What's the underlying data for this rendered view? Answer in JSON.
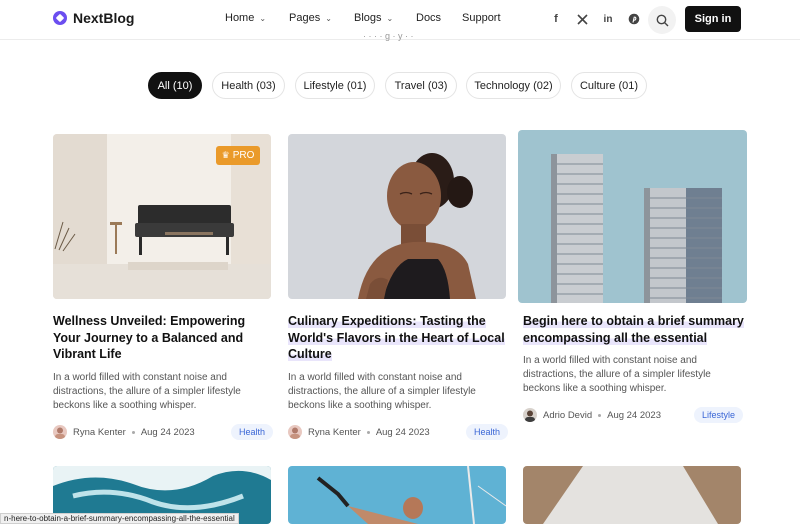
{
  "brand": {
    "name": "NextBlog",
    "accent": "#6b4ef0"
  },
  "nav": {
    "items": [
      {
        "label": "Home",
        "has_dropdown": true
      },
      {
        "label": "Pages",
        "has_dropdown": true
      },
      {
        "label": "Blogs",
        "has_dropdown": true
      },
      {
        "label": "Docs",
        "has_dropdown": false
      },
      {
        "label": "Support",
        "has_dropdown": false
      }
    ]
  },
  "social": [
    "facebook-icon",
    "x-icon",
    "linkedin-icon",
    "pinterest-icon"
  ],
  "header": {
    "signin_label": "Sign in",
    "stray_text": "· · · · g · y · ·"
  },
  "filters": [
    {
      "label": "All (10)",
      "active": true
    },
    {
      "label": "Health (03)",
      "active": false
    },
    {
      "label": "Lifestyle (01)",
      "active": false
    },
    {
      "label": "Travel (03)",
      "active": false
    },
    {
      "label": "Technology (02)",
      "active": false
    },
    {
      "label": "Culture (01)",
      "active": false
    }
  ],
  "posts": [
    {
      "title": "Wellness Unveiled: Empowering Your Journey to a Balanced and Vibrant Life",
      "excerpt": "In a world filled with constant noise and distractions, the allure of a simpler lifestyle beckons like a soothing whisper.",
      "author": "Ryna Kenter",
      "date": "Aug 24 2023",
      "category": "Health",
      "badge": "PRO"
    },
    {
      "title": "Culinary Expeditions: Tasting the World's Flavors in the Heart of Local Culture",
      "excerpt": "In a world filled with constant noise and distractions, the allure of a simpler lifestyle beckons like a soothing whisper.",
      "author": "Ryna Kenter",
      "date": "Aug 24 2023",
      "category": "Health"
    },
    {
      "title": "Begin here to obtain a brief summary encompassing all the essential",
      "excerpt": "In a world filled with constant noise and distractions, the allure of a simpler lifestyle beckons like a soothing whisper.",
      "author": "Adrio Devid",
      "date": "Aug 24 2023",
      "category": "Lifestyle"
    }
  ],
  "status_bar": {
    "url": "n-here-to-obtain-a-brief-summary-encompassing-all-the-essential"
  }
}
